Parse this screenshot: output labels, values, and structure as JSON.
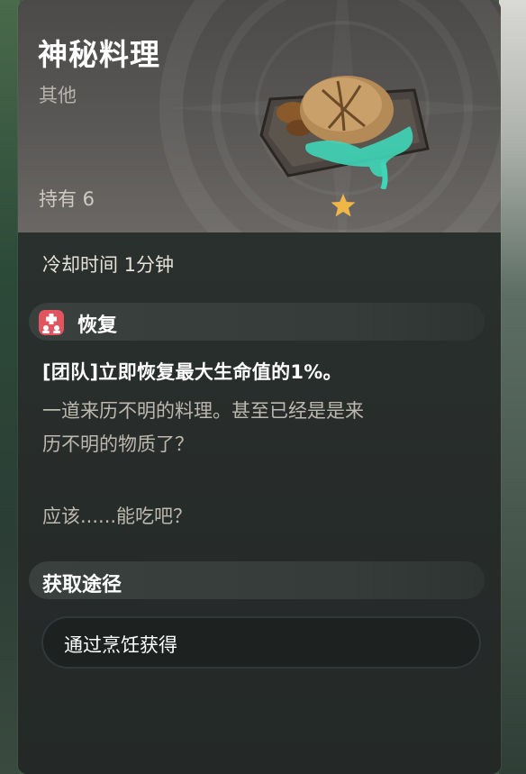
{
  "item": {
    "name": "神秘料理",
    "category": "其他",
    "held": "持有 6",
    "rarity_stars": 1,
    "star_color": "#f0b648"
  },
  "cooldown": "冷却时间 1分钟",
  "effect_section": {
    "icon": "heal-icon",
    "icon_color": "#e2545e",
    "label": "恢复",
    "effect_text": "[团队]立即恢复最大生命值的1%。",
    "description_lines": [
      "一道来历不明的料理。甚至已经是是来",
      "历不明的物质了？",
      "应该......能吃吧？"
    ]
  },
  "source_section": {
    "label": "获取途径",
    "methods": [
      "通过烹饪获得"
    ]
  },
  "colors": {
    "card_bg": "#242928",
    "header_bg": "#5a5856",
    "pill_bg": "#3a403e",
    "text_primary": "#ffffff",
    "text_secondary": "#bdb8af"
  }
}
